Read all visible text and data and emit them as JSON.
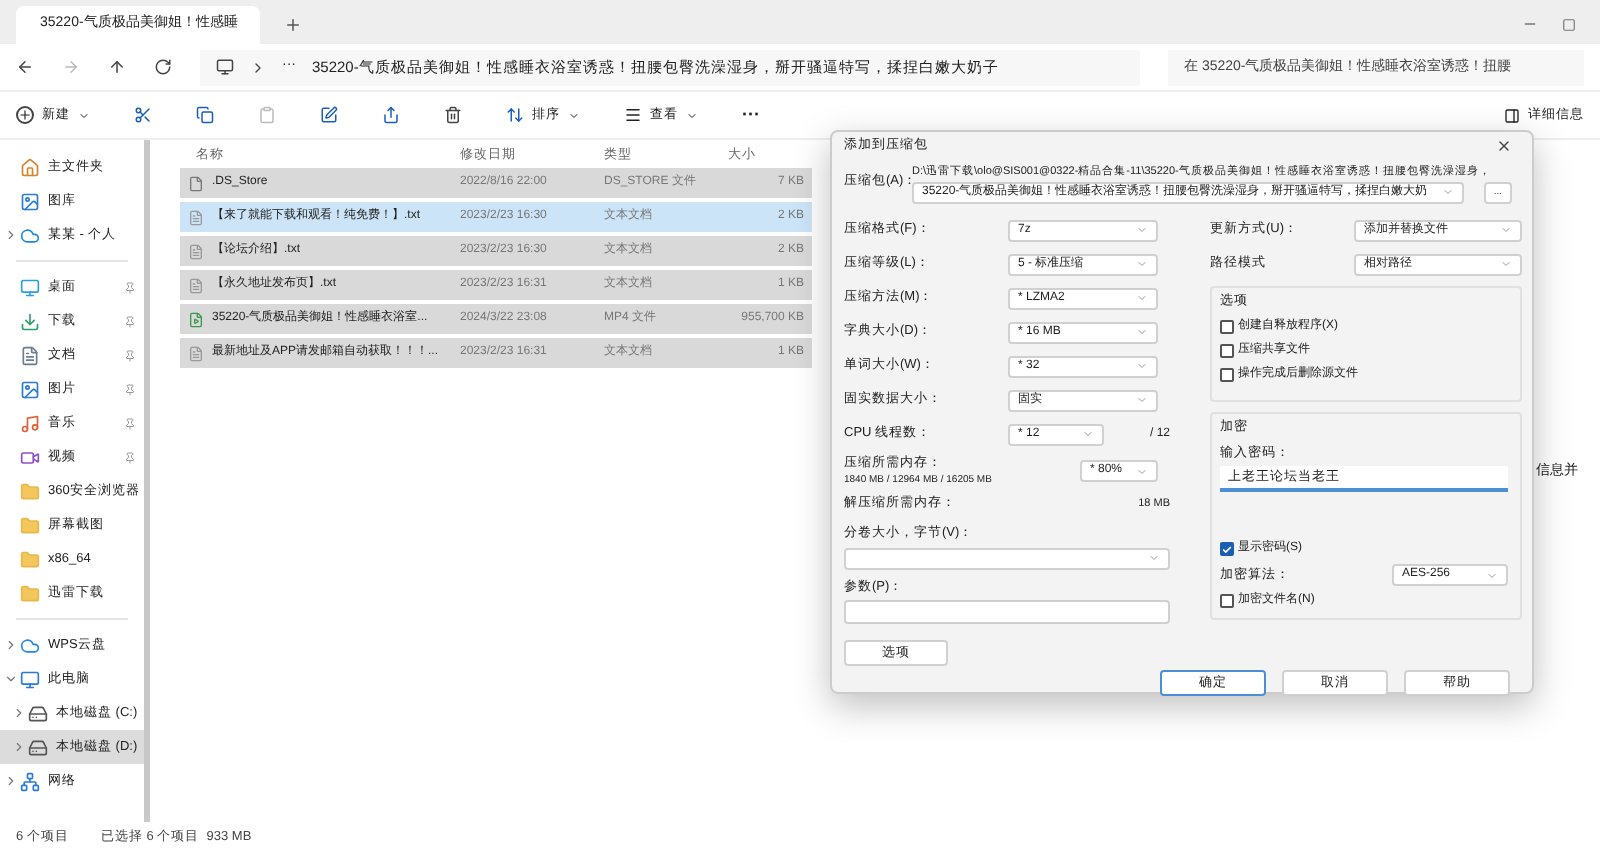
{
  "tab": {
    "title": "35220-气质极品美御姐！性感睡"
  },
  "address": {
    "overflow": "···",
    "path": "35220-气质极品美御姐！性感睡衣浴室诱惑！扭腰包臀洗澡湿身，掰开骚逼特写，揉捏白嫩大奶子",
    "search_placeholder": "在 35220-气质极品美御姐！性感睡衣浴室诱惑！扭腰"
  },
  "toolbar": {
    "new": "新建",
    "sort": "排序",
    "view": "查看",
    "more": "···",
    "details": "详细信息"
  },
  "sidebar": {
    "items": [
      {
        "kind": "home",
        "label": "主文件夹",
        "pinned": false,
        "selected": false
      },
      {
        "kind": "gallery",
        "label": "图库",
        "pinned": false,
        "selected": false
      },
      {
        "kind": "cloud",
        "label": "某某 - 个人",
        "pinned": false,
        "expanded": false,
        "selected": false
      },
      {
        "kind": "divider"
      },
      {
        "kind": "desktop",
        "label": "桌面",
        "pinned": true,
        "selected": false
      },
      {
        "kind": "download",
        "label": "下载",
        "pinned": true,
        "selected": false
      },
      {
        "kind": "docs",
        "label": "文档",
        "pinned": true,
        "selected": false
      },
      {
        "kind": "pictures",
        "label": "图片",
        "pinned": true,
        "selected": false
      },
      {
        "kind": "music",
        "label": "音乐",
        "pinned": true,
        "selected": false
      },
      {
        "kind": "video",
        "label": "视频",
        "pinned": true,
        "selected": false
      },
      {
        "kind": "folder",
        "label": "360安全浏览器",
        "pinned": false,
        "selected": false
      },
      {
        "kind": "folder",
        "label": "屏幕截图",
        "pinned": false,
        "selected": false
      },
      {
        "kind": "folder",
        "label": "x86_64",
        "pinned": false,
        "selected": false
      },
      {
        "kind": "folder",
        "label": "迅雷下载",
        "pinned": false,
        "selected": false
      },
      {
        "kind": "divider"
      },
      {
        "kind": "cloud",
        "label": "WPS云盘",
        "pinned": false,
        "selected": false,
        "expanded": false
      },
      {
        "kind": "pc",
        "label": "此电脑",
        "pinned": false,
        "selected": false,
        "expanded": true,
        "children": [
          {
            "kind": "drive",
            "label": "本地磁盘 (C:)",
            "selected": false
          },
          {
            "kind": "drive",
            "label": "本地磁盘 (D:)",
            "selected": true
          }
        ]
      },
      {
        "kind": "network",
        "label": "网络",
        "pinned": false,
        "selected": false,
        "expanded": false
      }
    ]
  },
  "table": {
    "columns": [
      "名称",
      "修改日期",
      "类型",
      "大小"
    ],
    "rows": [
      {
        "kind": "file",
        "name": ".DS_Store",
        "date": "2022/8/16 22:00",
        "type": "DS_STORE 文件",
        "size": "7 KB",
        "selected": true,
        "focused": false
      },
      {
        "kind": "text",
        "name": "【来了就能下载和观看！纯免费！】.txt",
        "date": "2023/2/23 16:30",
        "type": "文本文档",
        "size": "2 KB",
        "selected": true,
        "focused": true
      },
      {
        "kind": "text",
        "name": "【论坛介绍】.txt",
        "date": "2023/2/23 16:30",
        "type": "文本文档",
        "size": "2 KB",
        "selected": true,
        "focused": false
      },
      {
        "kind": "text",
        "name": "【永久地址发布页】.txt",
        "date": "2023/2/23 16:31",
        "type": "文本文档",
        "size": "1 KB",
        "selected": true,
        "focused": false
      },
      {
        "kind": "video",
        "name": "35220-气质极品美御姐！性感睡衣浴室...",
        "date": "2024/3/22 23:08",
        "type": "MP4 文件",
        "size": "955,700 KB",
        "selected": true,
        "focused": false
      },
      {
        "kind": "text",
        "name": "最新地址及APP请发邮箱自动获取！！！...",
        "date": "2023/2/23 16:31",
        "type": "文本文档",
        "size": "1 KB",
        "selected": true,
        "focused": false
      }
    ]
  },
  "status_bar": {
    "count": "6 个项目",
    "selection": "已选择 6 个项目  933 MB"
  },
  "details_pane": {
    "text": "信息并"
  },
  "dialog": {
    "title": "添加到压缩包",
    "archive_label": "压缩包(A)：",
    "archive_path": "D:\\迅雷下载\\olo@SIS001@0322-精品合集-11\\35220-气质极品美御姐！性感睡衣浴室诱惑！扭腰包臀洗澡湿身，",
    "archive_name": "35220-气质极品美御姐！性感睡衣浴室诱惑！扭腰包臀洗澡湿身，掰开骚逼特写，揉捏白嫩大奶",
    "browse": "...",
    "left": [
      {
        "kind": "select",
        "label": "压缩格式(F)：",
        "value": "7z"
      },
      {
        "kind": "select",
        "label": "压缩等级(L)：",
        "value": "5 - 标准压缩"
      },
      {
        "kind": "select",
        "label": "压缩方法(M)：",
        "value": "* LZMA2"
      },
      {
        "kind": "select",
        "label": "字典大小(D)：",
        "value": "* 16 MB"
      },
      {
        "kind": "select",
        "label": "单词大小(W)：",
        "value": "* 32"
      },
      {
        "kind": "select",
        "label": "固实数据大小：",
        "value": "固实"
      },
      {
        "kind": "threads",
        "label": "CPU 线程数：",
        "value": "* 12",
        "suffix": "/ 12"
      },
      {
        "kind": "memory",
        "label": "压缩所需内存：",
        "sub": "1840 MB / 12964 MB / 16205 MB",
        "value": "* 80%"
      },
      {
        "kind": "reading",
        "label": "解压缩所需内存：",
        "value": "18 MB"
      },
      {
        "kind": "wide_select",
        "label": "分卷大小，字节(V)："
      },
      {
        "kind": "wide_input",
        "label": "参数(P)："
      }
    ],
    "options_button": "选项",
    "right": [
      {
        "label": "更新方式(U)：",
        "value": "添加并替换文件"
      },
      {
        "label": "路径模式",
        "value": "相对路径"
      }
    ],
    "options": {
      "title": "选项",
      "items": [
        {
          "label": "创建自释放程序(X)",
          "checked": false
        },
        {
          "label": "压缩共享文件",
          "checked": false
        },
        {
          "label": "操作完成后删除源文件",
          "checked": false
        }
      ]
    },
    "encryption": {
      "title": "加密",
      "password_label": "输入密码：",
      "password": "上老王论坛当老王",
      "show_password": {
        "label": "显示密码(S)",
        "checked": true
      },
      "method_label": "加密算法：",
      "method": "AES-256",
      "encrypt_names": {
        "label": "加密文件名(N)",
        "checked": false
      }
    },
    "buttons": [
      {
        "label": "确定",
        "default": true
      },
      {
        "label": "取消",
        "default": false
      },
      {
        "label": "帮助",
        "default": false
      }
    ]
  }
}
